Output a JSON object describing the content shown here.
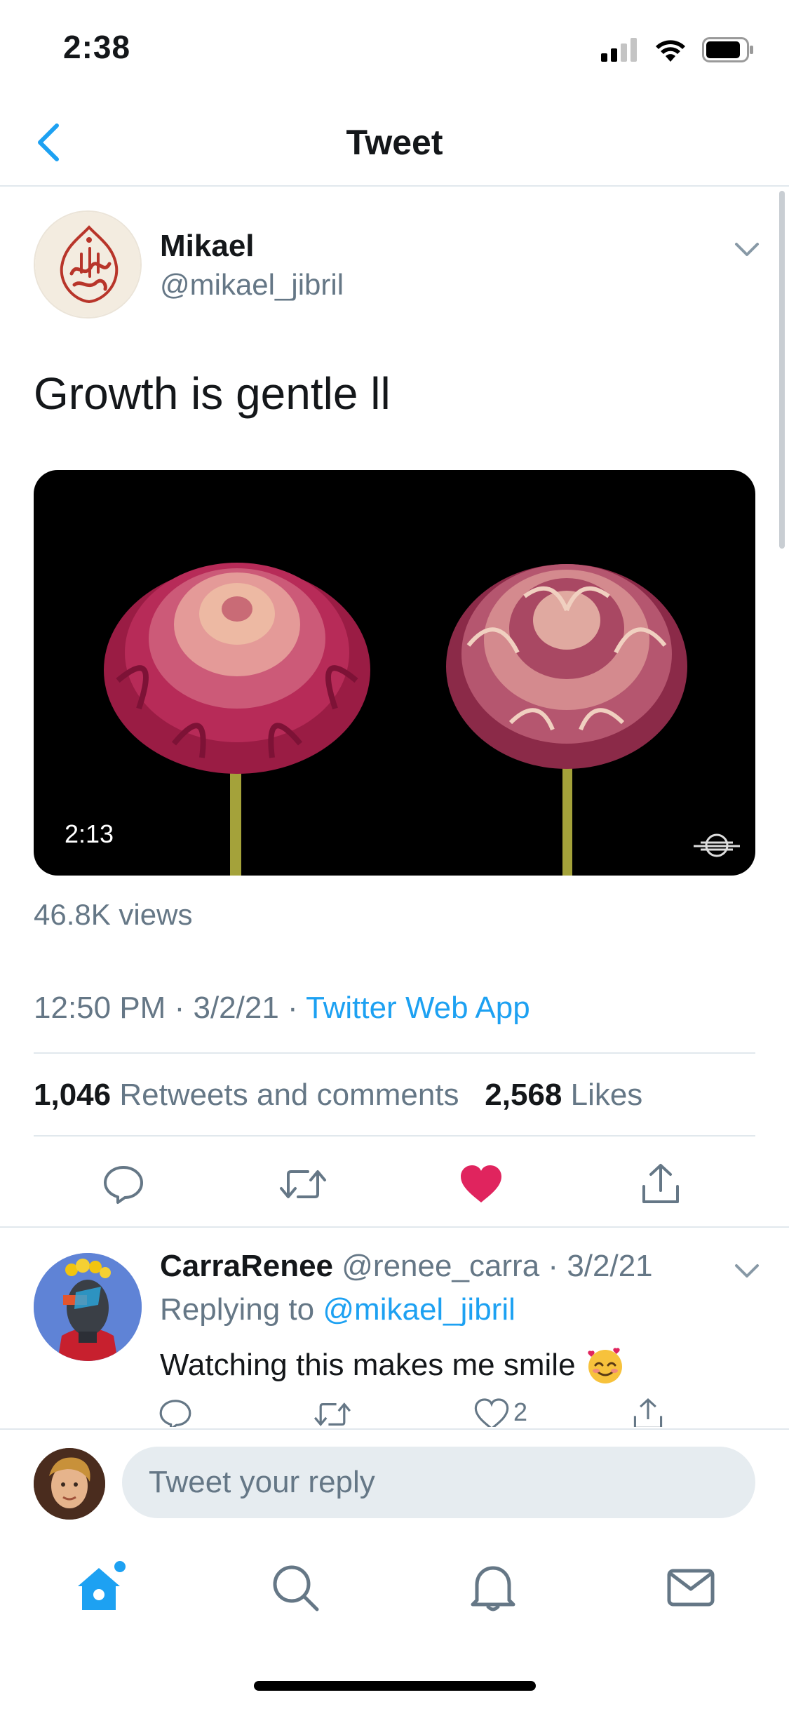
{
  "status_bar": {
    "time": "2:38",
    "icons": [
      "cellular-signal-icon",
      "wifi-icon",
      "battery-icon"
    ]
  },
  "header": {
    "title": "Tweet",
    "back_icon": "chevron-left-icon"
  },
  "tweet": {
    "author_name": "Mikael",
    "author_handle": "@mikael_jibril",
    "text": "Growth is gentle ll",
    "video_duration": "2:13",
    "views": "46.8K views",
    "time": "12:50 PM",
    "separator": "·",
    "date": "3/2/21",
    "source": "Twitter Web App",
    "retweets_count": "1,046",
    "retweets_label": "Retweets and comments",
    "likes_count": "2,568",
    "likes_label": "Likes",
    "liked": true,
    "actions": [
      "reply-icon",
      "retweet-icon",
      "like-icon",
      "share-icon"
    ]
  },
  "reply": {
    "name": "CarraRenee",
    "handle": "@renee_carra",
    "separator": "·",
    "date": "3/2/21",
    "replying_prefix": "Replying to",
    "replying_to": "@mikael_jibril",
    "text": "Watching this makes me smile",
    "emoji": "smiling-face-with-hearts-emoji",
    "like_count": "2"
  },
  "composer": {
    "placeholder": "Tweet your reply"
  },
  "tab_bar": {
    "tabs": [
      "home-icon",
      "search-icon",
      "notifications-icon",
      "messages-icon"
    ],
    "active": "home-icon"
  },
  "colors": {
    "accent": "#1da1f2",
    "like": "#e0245e",
    "secondary_text": "#657786",
    "divider": "#e1e8ed"
  }
}
